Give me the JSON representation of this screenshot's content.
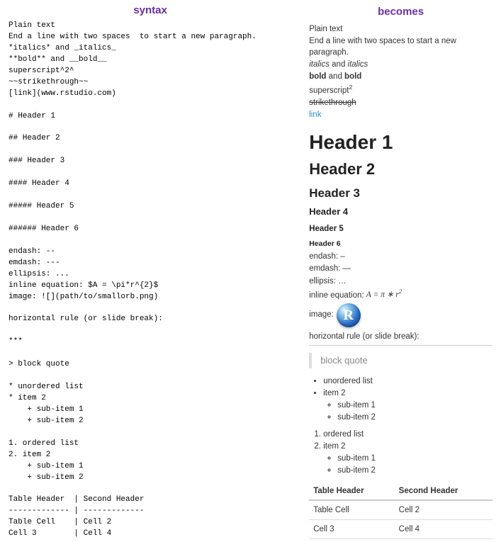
{
  "titles": {
    "left": "syntax",
    "right": "becomes"
  },
  "syntax_lines": [
    "Plain text",
    "End a line with two spaces  to start a new paragraph.",
    "*italics* and _italics_",
    "**bold** and __bold__",
    "superscript^2^",
    "~~strikethrough~~",
    "[link](www.rstudio.com)",
    "",
    "# Header 1",
    "",
    "## Header 2",
    "",
    "### Header 3",
    "",
    "#### Header 4",
    "",
    "##### Header 5",
    "",
    "###### Header 6",
    "",
    "endash: --",
    "emdash: ---",
    "ellipsis: ...",
    "inline equation: $A = \\pi*r^{2}$",
    "image: ![](path/to/smallorb.png)",
    "",
    "horizontal rule (or slide break):",
    "",
    "***",
    "",
    "> block quote",
    "",
    "* unordered list",
    "* item 2",
    "    + sub-item 1",
    "    + sub-item 2",
    "",
    "1. ordered list",
    "2. item 2",
    "    + sub-item 1",
    "    + sub-item 2",
    "",
    "Table Header  | Second Header",
    "------------- | -------------",
    "Table Cell    | Cell 2",
    "Cell 3        | Cell 4"
  ],
  "rendered": {
    "plain": "Plain text",
    "newpara": "End a line with two spaces to start a new paragraph.",
    "italics_word": "italics",
    "and": " and ",
    "bold_word": "bold",
    "super_label": "superscript",
    "super_exp": "2",
    "strike_word": "strikethrough",
    "link_text": "link",
    "h1": "Header 1",
    "h2": "Header 2",
    "h3": "Header 3",
    "h4": "Header 4",
    "h5": "Header 5",
    "h6": "Header 6",
    "endash_label": "endash: ",
    "endash": "–",
    "emdash_label": "emdash: ",
    "emdash": "—",
    "ellipsis_label": "ellipsis: ",
    "ellipsis": "…",
    "inline_eq_label": "inline equation: ",
    "eq_A": "A",
    "eq_eq": " = ",
    "eq_pi": "π",
    "eq_star": " ∗ ",
    "eq_r": "r",
    "eq_exp": "2",
    "image_label": "image:",
    "orb_letter": "R",
    "hr_label": "horizontal rule (or slide break):",
    "blockquote": "block quote",
    "ul": {
      "i1": "unordered list",
      "i2": "item 2",
      "s1": "sub-item 1",
      "s2": "sub-item 2"
    },
    "ol": {
      "i1": "ordered list",
      "i2": "item 2",
      "s1": "sub-item 1",
      "s2": "sub-item 2"
    },
    "table": {
      "h1": "Table Header",
      "h2": "Second Header",
      "r1c1": "Table Cell",
      "r1c2": "Cell 2",
      "r2c1": "Cell 3",
      "r2c2": "Cell 4"
    }
  }
}
